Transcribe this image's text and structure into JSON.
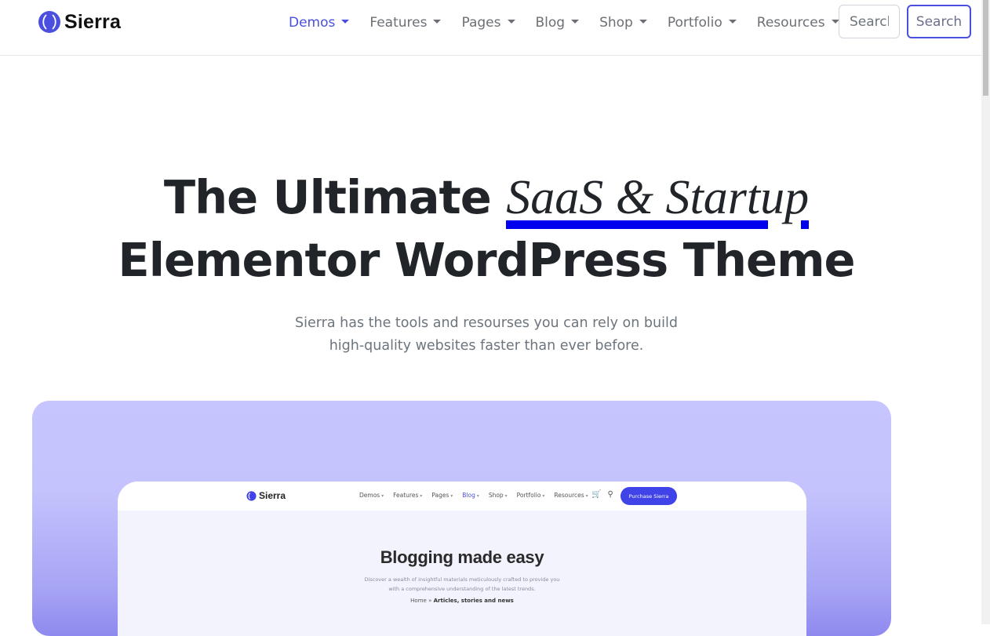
{
  "brand": {
    "name": "Sierra"
  },
  "nav": {
    "items": [
      {
        "label": "Demos",
        "active": true
      },
      {
        "label": "Features"
      },
      {
        "label": "Pages"
      },
      {
        "label": "Blog"
      },
      {
        "label": "Shop"
      },
      {
        "label": "Portfolio"
      },
      {
        "label": "Resources"
      }
    ]
  },
  "search": {
    "placeholder": "Search",
    "button_label": "Search"
  },
  "hero": {
    "title_prefix": "The Ultimate",
    "title_highlight": "SaaS & Startup",
    "title_line2": "Elementor WordPress Theme",
    "subtitle_line1": "Sierra has the tools and resourses you can rely on build",
    "subtitle_line2": "high-quality websites faster than ever before."
  },
  "preview": {
    "brand_name": "Sierra",
    "menu": [
      "Demos",
      "Features",
      "Pages",
      "Blog",
      "Shop",
      "Portfolio",
      "Resources"
    ],
    "active_menu": "Blog",
    "cta_label": "Purchase Sierra",
    "title": "Blogging made easy",
    "description_line1": "Discover a wealth of insightful materials meticulously crafted to provide you",
    "description_line2": "with a comprehensive understanding of the latest trends.",
    "breadcrumb_home": "Home",
    "breadcrumb_separator": "»",
    "breadcrumb_current": "Articles, stories and news"
  },
  "colors": {
    "accent": "#4a4fe0",
    "highlight_underline": "#0000ee",
    "text_dark": "#212529",
    "text_muted": "#6c757d",
    "preview_bg_top": "#c7c5fd",
    "preview_bg_bottom": "#8e89ee"
  },
  "icons": {
    "brand_logo": "sierra-logo-icon",
    "caret": "caret-down-icon",
    "cart": "cart-icon",
    "search": "search-icon"
  }
}
